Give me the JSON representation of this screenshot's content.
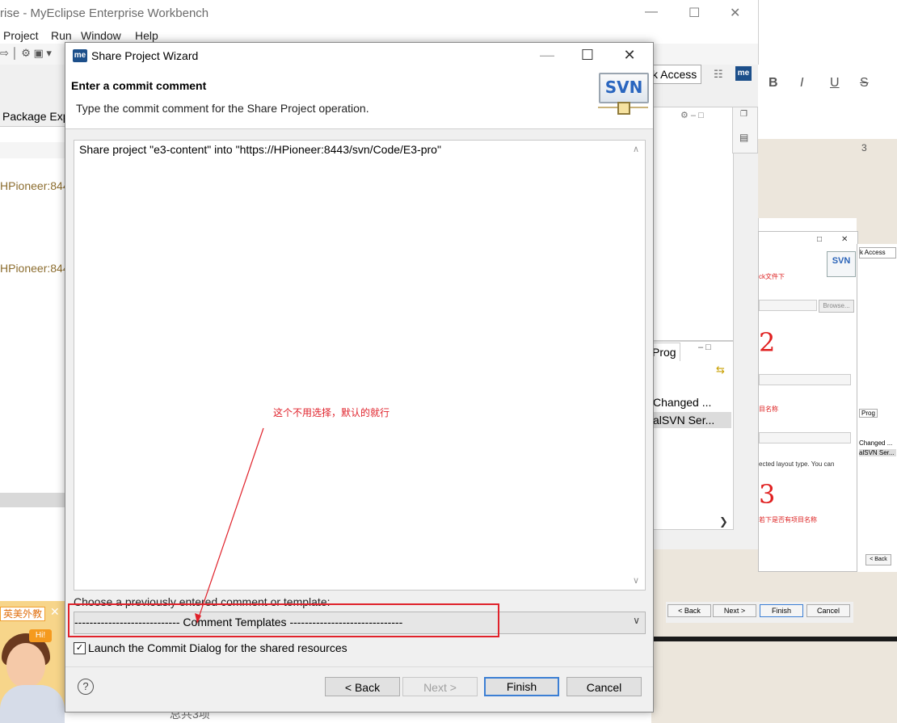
{
  "background_app": {
    "title": "rise - MyEclipse Enterprise Workbench",
    "menu": [
      "Project",
      "Run",
      "Window",
      "Help"
    ],
    "quick_access": "k Access",
    "left_tab": "Package Exp",
    "left_rows": [
      "HPioneer:844",
      "HPioneer:844"
    ],
    "right_tab": "Prog",
    "right_rows": [
      "Changed ...",
      "alSVN Ser..."
    ],
    "page_number": "3",
    "bottom_text": "总共3项"
  },
  "right_screenshot": {
    "svn_label": "SVN",
    "red_note_1": "ck文件下",
    "browse": "Browse...",
    "num_2": "2",
    "red_note_2": "目名称",
    "note": "ected layout type. You can",
    "num_3": "3",
    "red_note_3": "若下是否有项目名称",
    "buttons": [
      "< Back",
      "Next >",
      "Finish",
      "Cancel"
    ],
    "quick_access": "k Access",
    "prog": "Prog",
    "rows": [
      "Changed ...",
      "alSVN Ser..."
    ],
    "back": "< Back"
  },
  "ad": {
    "label": "英美外教",
    "hi": "Hi!"
  },
  "dialog": {
    "title": "Share Project Wizard",
    "icon_text": "me",
    "banner_title": "Enter a commit comment",
    "banner_subtitle": "Type the commit comment for the Share Project operation.",
    "svn_logo": "SVN",
    "comment": "Share project \"e3-content\" into \"https://HPioneer:8443/svn/Code/E3-pro\"",
    "choose_label": "Choose a previously entered comment or template:",
    "template_select": "---------------------------- Comment Templates ------------------------------",
    "launch_commit_checked": true,
    "launch_commit_label": "Launch the Commit Dialog for the shared resources",
    "buttons": {
      "back": "< Back",
      "next": "Next >",
      "finish": "Finish",
      "cancel": "Cancel"
    }
  },
  "annotation": {
    "text": "这个不用选择，默认的就行",
    "color": "#e0222b"
  }
}
